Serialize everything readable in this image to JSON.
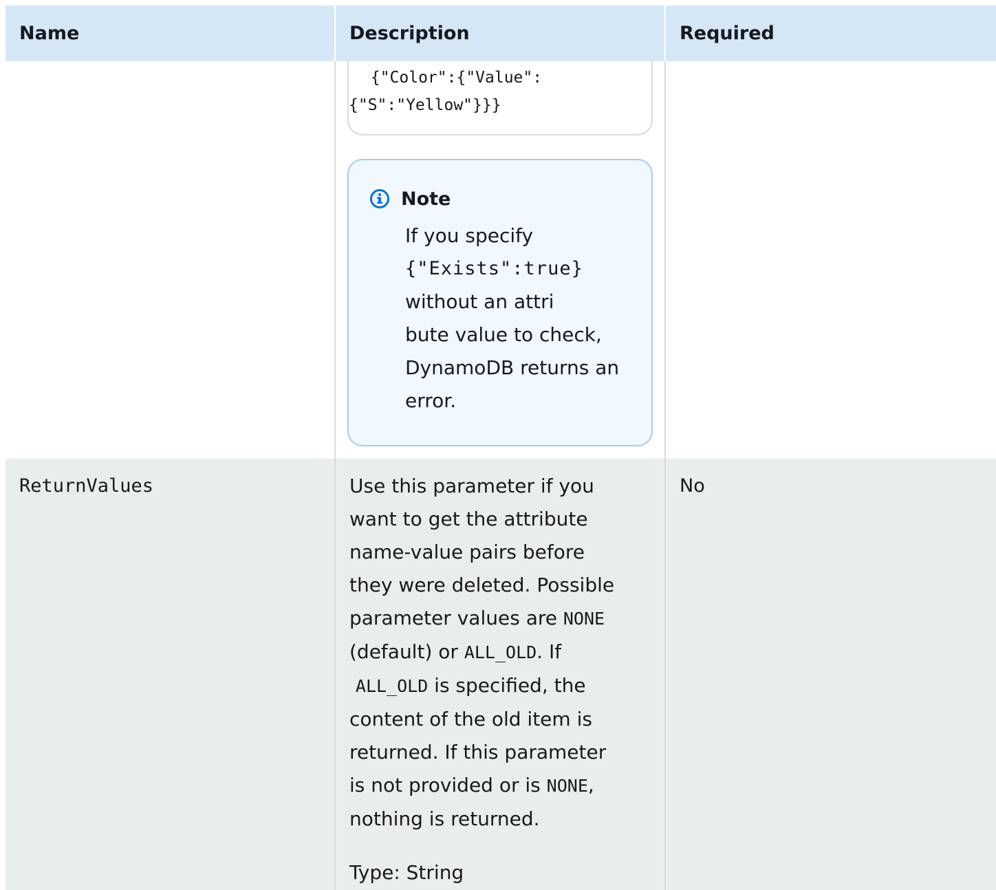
{
  "table": {
    "headers": {
      "name": "Name",
      "description": "Description",
      "required": "Required"
    },
    "row_prev": {
      "code_line1": " {\"Color\":{\"Value\":",
      "code_line2": "{\"S\":\"Yellow\"}}}",
      "note": {
        "icon": "info-icon",
        "title": "Note",
        "text1": "If you specify",
        "code": "{\"Exists\":true}",
        "text2": "without an  attri",
        "text3": "bute value to check,",
        "text4": "DynamoDB returns an",
        "text5": "error."
      }
    },
    "row_return_values": {
      "name": "ReturnValues",
      "desc_p1": "Use this parameter if you",
      "desc_p2": "want to get the attribute",
      "desc_p3": "name-value pairs before",
      "desc_p4": "they were  deleted. Possible",
      "desc_p5a": "parameter values are ",
      "desc_code_none1": "NONE",
      "desc_p6a": "(default) or ",
      "desc_code_allold1": "ALL_OLD",
      "desc_p6b": ". If",
      "desc_code_allold2": "ALL_OLD",
      "desc_p7b": " is specified, the",
      "desc_p8": "content of the old  item is",
      "desc_p9": "returned. If this parameter",
      "desc_p10a": "is not provided or is ",
      "desc_code_none2": "NONE",
      "desc_p10b": ",",
      "desc_p11": "nothing is returned.",
      "type_line": "Type: String",
      "required": "No"
    }
  },
  "colors": {
    "header_bg": "#d5e6f7",
    "row_alt_bg": "#eaeded",
    "note_bg": "#f1f8ff",
    "note_border": "#a6cbf0",
    "info_icon": "#0972d3"
  }
}
